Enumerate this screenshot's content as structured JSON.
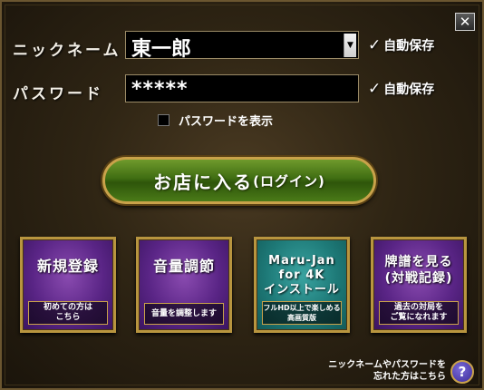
{
  "close_symbol": "✕",
  "nickname": {
    "label": "ニックネーム",
    "value": "東一郎",
    "dropdown_arrow": "▼",
    "autosave_mark": "✓",
    "autosave_label": "自動保存"
  },
  "password": {
    "label": "パスワード",
    "value": "*****",
    "autosave_mark": "✓",
    "autosave_label": "自動保存"
  },
  "show_password": {
    "label": "パスワードを表示",
    "checked": false
  },
  "login_button": {
    "main": "お店に入る",
    "sub": "(ログイン)"
  },
  "tiles": [
    {
      "title": "新規登録",
      "desc": "初めての方は\nこちら",
      "color": "purple"
    },
    {
      "title": "音量調節",
      "desc": "音量を調整します",
      "color": "purple"
    },
    {
      "title": "Maru-Jan for 4K\nインストール",
      "desc": "フルHD以上で楽しめる\n高画質版",
      "color": "teal"
    },
    {
      "title": "牌譜を見る\n(対戦記録)",
      "desc": "過去の対局を\nご覧になれます",
      "color": "purple"
    }
  ],
  "help": {
    "text": "ニックネームやパスワードを\n忘れた方はこちら",
    "icon": "?"
  },
  "colors": {
    "frame_gold": "#c9a24a",
    "tile_purple": "#5a2586",
    "tile_teal": "#1e7a78",
    "login_green": "#3f6d12"
  }
}
